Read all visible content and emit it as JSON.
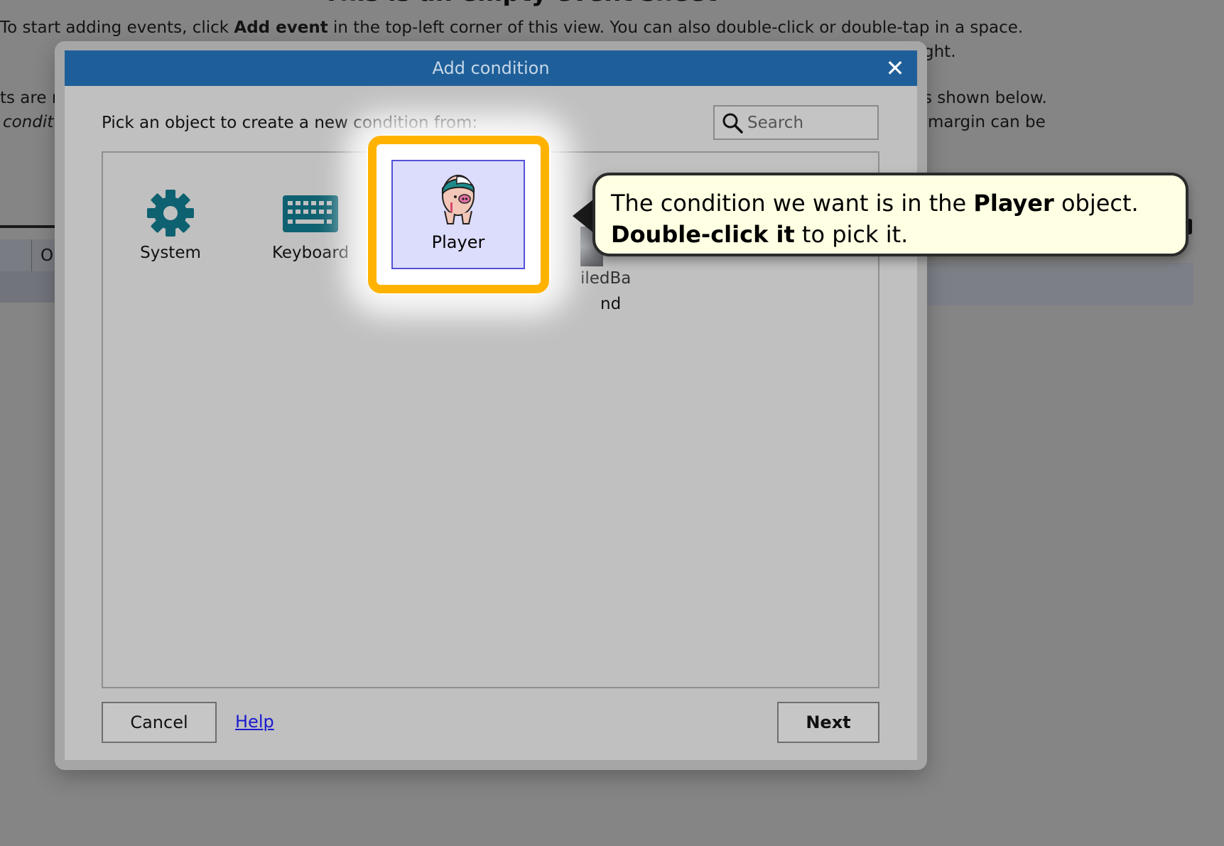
{
  "background": {
    "title": "This is an empty event sheet",
    "line1_a": "To start adding events, click ",
    "line1_b": "Add event",
    "line1_c": " in the top-left corner of this view. You can also double-click or double-tap in a space.",
    "line2_right": "ght.",
    "line3_left": "ts are r",
    "line3_right": "s shown below.",
    "line4_left": "condit",
    "line4_right": "margin can be",
    "row_cell": "O"
  },
  "dialog": {
    "title": "Add condition",
    "prompt": "Pick an object to create a new condition from:",
    "search_placeholder": "Search",
    "objects": [
      {
        "label": "System",
        "icon": "gear-icon"
      },
      {
        "label": "Keyboard",
        "icon": "keyboard-icon"
      },
      {
        "label": "Player",
        "icon": "player-sprite-icon",
        "selected": true
      },
      {
        "label_part1": "iledBa",
        "label_part2": "nd",
        "icon": "tiled-background-thumbnail"
      }
    ],
    "cancel_label": "Cancel",
    "help_label": "Help",
    "next_label": "Next"
  },
  "callout": {
    "part1": "The condition we want is in the ",
    "part2": "Player",
    "part3": " object.",
    "part4": "Double-click it",
    "part5": " to pick it."
  },
  "colors": {
    "titlebar": "#1f5f99",
    "highlight": "#ffb300",
    "selection_fill": "#dcdcfd",
    "selection_border": "#5252d6",
    "callout_fill": "#ffffe3",
    "icon_teal": "#0e6170"
  }
}
